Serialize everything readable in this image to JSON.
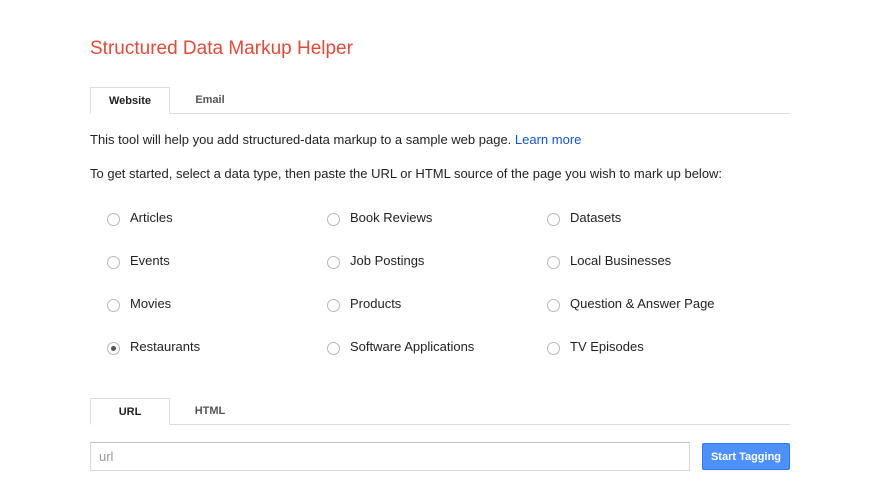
{
  "app": {
    "title": "Structured Data Markup Helper"
  },
  "source_tabs": [
    {
      "label": "Website",
      "active": true
    },
    {
      "label": "Email",
      "active": false
    }
  ],
  "intro": {
    "text": "This tool will help you add structured-data markup to a sample web page. ",
    "link_label": "Learn more"
  },
  "instructions": "To get started, select a data type, then paste the URL or HTML source of the page you wish to mark up below:",
  "data_types": [
    {
      "label": "Articles",
      "checked": false
    },
    {
      "label": "Book Reviews",
      "checked": false
    },
    {
      "label": "Datasets",
      "checked": false
    },
    {
      "label": "Events",
      "checked": false
    },
    {
      "label": "Job Postings",
      "checked": false
    },
    {
      "label": "Local Businesses",
      "checked": false
    },
    {
      "label": "Movies",
      "checked": false
    },
    {
      "label": "Products",
      "checked": false
    },
    {
      "label": "Question & Answer Page",
      "checked": false
    },
    {
      "label": "Restaurants",
      "checked": true
    },
    {
      "label": "Software Applications",
      "checked": false
    },
    {
      "label": "TV Episodes",
      "checked": false
    }
  ],
  "input_tabs": [
    {
      "label": "URL",
      "active": true
    },
    {
      "label": "HTML",
      "active": false
    }
  ],
  "url_field": {
    "value": "",
    "placeholder": "url"
  },
  "start_button": {
    "label": "Start Tagging"
  },
  "colors": {
    "title": "#dd4b39",
    "link": "#1155cc",
    "button": "#4d90fe"
  }
}
